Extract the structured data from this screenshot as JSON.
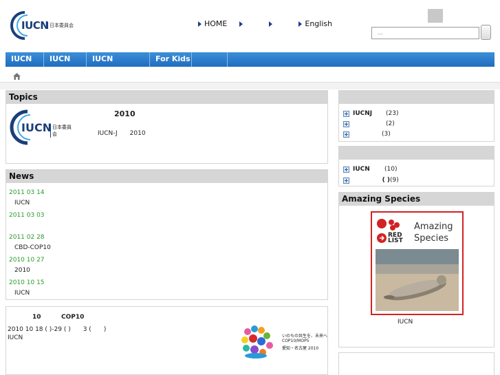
{
  "header": {
    "logo_text": "IUCN",
    "logo_sub": "日本委員会",
    "nav": [
      "HOME",
      "",
      "",
      "English"
    ],
    "search_placeholder": "..."
  },
  "mainnav": [
    "IUCN",
    "IUCN",
    "IUCN",
    "For Kids",
    ""
  ],
  "topics": {
    "title": "Topics",
    "headline": "2010",
    "line": "IUCN-J　　2010",
    "logo_text": "IUCN",
    "logo_sub": "日本委員会"
  },
  "news": {
    "title": "News",
    "items": [
      {
        "date": "2011 03 14",
        "text": "IUCN"
      },
      {
        "date": "2011 03 03",
        "text": ""
      },
      {
        "date": "2011 02 28",
        "text": "CBD-COP10"
      },
      {
        "date": "2010 10 27",
        "text": "2010"
      },
      {
        "date": "2010 10 15",
        "text": "IUCN"
      }
    ]
  },
  "cop": {
    "l1a": "10",
    "l1b": "COP10",
    "l2": "2010 10 18 ( )-29 ( )　　3 (　　)",
    "l3": "IUCN",
    "mark_l1": "いのちの共生を、未来へ",
    "mark_l2": "COP10/MOP5",
    "mark_l3": "愛知・名古屋 2010"
  },
  "side1": {
    "title": "",
    "items": [
      {
        "label": "IUCNJ",
        "count": "(23)"
      },
      {
        "label": "",
        "count": "(2)"
      },
      {
        "label": "",
        "count": "(3)"
      }
    ]
  },
  "side2": {
    "title": "",
    "items": [
      {
        "label": "IUCN",
        "count": "(10)"
      },
      {
        "label": "( )",
        "count": "(9)"
      }
    ]
  },
  "amazing": {
    "title": "Amazing Species",
    "card_title_1": "Amazing",
    "card_title_2": "Species",
    "red": "RED",
    "list": "LIST",
    "caption": "IUCN"
  },
  "colors": {
    "nav_blue": "#2a78c8",
    "news_date": "#2a9a2a",
    "card_border": "#d22222"
  }
}
